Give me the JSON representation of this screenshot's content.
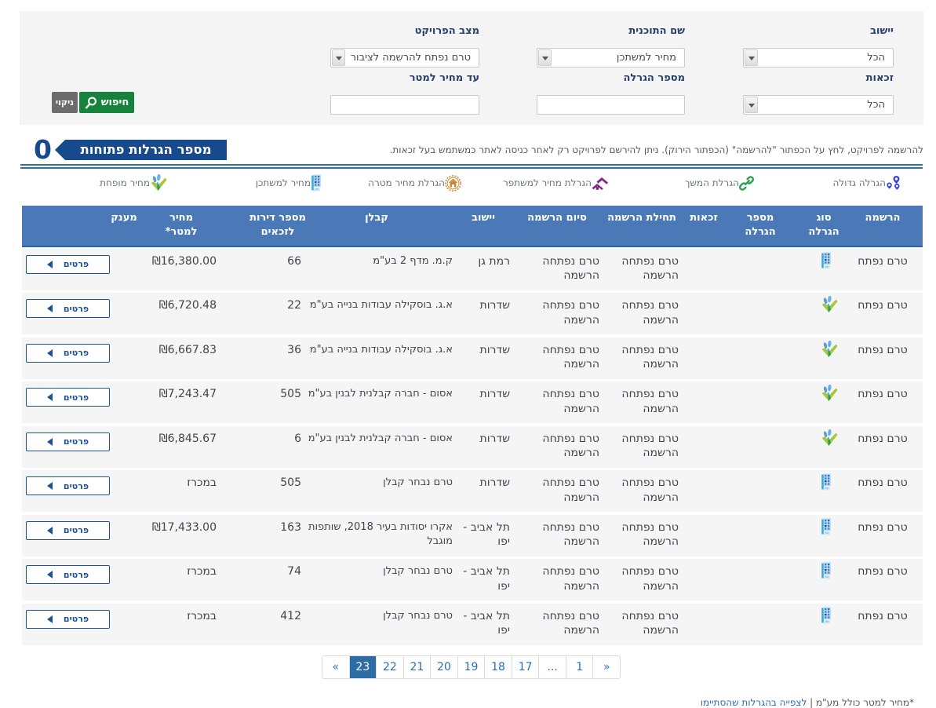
{
  "filters": {
    "fields": [
      {
        "label": "יישוב",
        "type": "select",
        "value": "הכל"
      },
      {
        "label": "שם התוכנית",
        "type": "select",
        "value": "מחיר למשתכן"
      },
      {
        "label": "מצב הפרויקט",
        "type": "select",
        "value": "טרם נפתח להרשמה לציבור"
      },
      {
        "label": "זכאות",
        "type": "select",
        "value": "הכל"
      },
      {
        "label": "מספר הגרלה",
        "type": "input",
        "value": ""
      },
      {
        "label": "עד מחיר למטר",
        "type": "input",
        "value": ""
      }
    ],
    "search_label": "חיפוש",
    "clear_label": "ניקוי"
  },
  "note": "להרשמה לפרויקט, לחץ על הכפתור \"להרשמה\" (הכפתור הירוק). ניתן להירשם לפרויקט רק לאחר כניסה לאתר כמשתמש בעל זכאות.",
  "summary": {
    "label": "מספר הגרלות פתוחות",
    "value": "0"
  },
  "legend": [
    {
      "label": "הגרלה גדולה",
      "icon": "pins-icon"
    },
    {
      "label": "הגרלת המשך",
      "icon": "link-icon"
    },
    {
      "label": "הגרלת מחיר למשתפר",
      "icon": "improver-house-icon"
    },
    {
      "label": "הגרלת מחיר מטרה",
      "icon": "target-price-icon"
    },
    {
      "label": "מחיר למשתכן",
      "icon": "building-icon"
    },
    {
      "label": "מחיר מופחת",
      "icon": "reduced-price-icon"
    }
  ],
  "table": {
    "columns": [
      "הרשמה",
      "סוג הגרלה",
      "מספר הגרלה",
      "זכאות",
      "תחילת הרשמה",
      "סיום הרשמה",
      "יישוב",
      "קבלן",
      "מספר דירות לזכאים",
      "מחיר למטר*",
      "מענק"
    ],
    "details_label": "פרטים",
    "rows": [
      {
        "status": "טרם נפתח",
        "type_icon": "building-icon",
        "lottery_no": "",
        "eligibility": "",
        "reg_start": "טרם נפתחה הרשמה",
        "reg_end": "טרם נפתחה הרשמה",
        "city": "רמת גן",
        "contractor": "ק.מ. מדף 2 בע\"מ",
        "units": "66",
        "price": "₪16,380.00",
        "grant": ""
      },
      {
        "status": "טרם נפתח",
        "type_icon": "reduced-price-icon",
        "lottery_no": "",
        "eligibility": "",
        "reg_start": "טרם נפתחה הרשמה",
        "reg_end": "טרם נפתחה הרשמה",
        "city": "שדרות",
        "contractor": "א.ג. בוסקילה עבודות בנייה בע\"מ",
        "units": "22",
        "price": "₪6,720.48",
        "grant": ""
      },
      {
        "status": "טרם נפתח",
        "type_icon": "reduced-price-icon",
        "lottery_no": "",
        "eligibility": "",
        "reg_start": "טרם נפתחה הרשמה",
        "reg_end": "טרם נפתחה הרשמה",
        "city": "שדרות",
        "contractor": "א.ג. בוסקילה עבודות בנייה בע\"מ",
        "units": "36",
        "price": "₪6,667.83",
        "grant": ""
      },
      {
        "status": "טרם נפתח",
        "type_icon": "reduced-price-icon",
        "lottery_no": "",
        "eligibility": "",
        "reg_start": "טרם נפתחה הרשמה",
        "reg_end": "טרם נפתחה הרשמה",
        "city": "שדרות",
        "contractor": "אסום - חברה קבלנית לבנין בע\"מ",
        "units": "505",
        "price": "₪7,243.47",
        "grant": ""
      },
      {
        "status": "טרם נפתח",
        "type_icon": "reduced-price-icon",
        "lottery_no": "",
        "eligibility": "",
        "reg_start": "טרם נפתחה הרשמה",
        "reg_end": "טרם נפתחה הרשמה",
        "city": "שדרות",
        "contractor": "אסום - חברה קבלנית לבנין בע\"מ",
        "units": "6",
        "price": "₪6,845.67",
        "grant": ""
      },
      {
        "status": "טרם נפתח",
        "type_icon": "building-icon",
        "lottery_no": "",
        "eligibility": "",
        "reg_start": "טרם נפתחה הרשמה",
        "reg_end": "טרם נפתחה הרשמה",
        "city": "שדרות",
        "contractor": "טרם נבחר קבלן",
        "units": "505",
        "price": "במכרז",
        "grant": ""
      },
      {
        "status": "טרם נפתח",
        "type_icon": "building-icon",
        "lottery_no": "",
        "eligibility": "",
        "reg_start": "טרם נפתחה הרשמה",
        "reg_end": "טרם נפתחה הרשמה",
        "city": "תל אביב - יפו",
        "contractor": "אקרו יסודות בעיר 2018, שותפות מוגבל",
        "units": "163",
        "price": "₪17,433.00",
        "grant": ""
      },
      {
        "status": "טרם נפתח",
        "type_icon": "building-icon",
        "lottery_no": "",
        "eligibility": "",
        "reg_start": "טרם נפתחה הרשמה",
        "reg_end": "טרם נפתחה הרשמה",
        "city": "תל אביב - יפו",
        "contractor": "טרם נבחר קבלן",
        "units": "74",
        "price": "במכרז",
        "grant": ""
      },
      {
        "status": "טרם נפתח",
        "type_icon": "building-icon",
        "lottery_no": "",
        "eligibility": "",
        "reg_start": "טרם נפתחה הרשמה",
        "reg_end": "טרם נפתחה הרשמה",
        "city": "תל אביב - יפו",
        "contractor": "טרם נבחר קבלן",
        "units": "412",
        "price": "במכרז",
        "grant": ""
      }
    ]
  },
  "pagination": {
    "items": [
      "«",
      "23",
      "22",
      "21",
      "20",
      "19",
      "18",
      "17",
      "...",
      "1",
      "»"
    ],
    "active": "23"
  },
  "footer_note": {
    "text": "*מחיר למטר כולל מע\"מ | ",
    "link": "לצפייה בהגרלות שהסתיימו"
  }
}
